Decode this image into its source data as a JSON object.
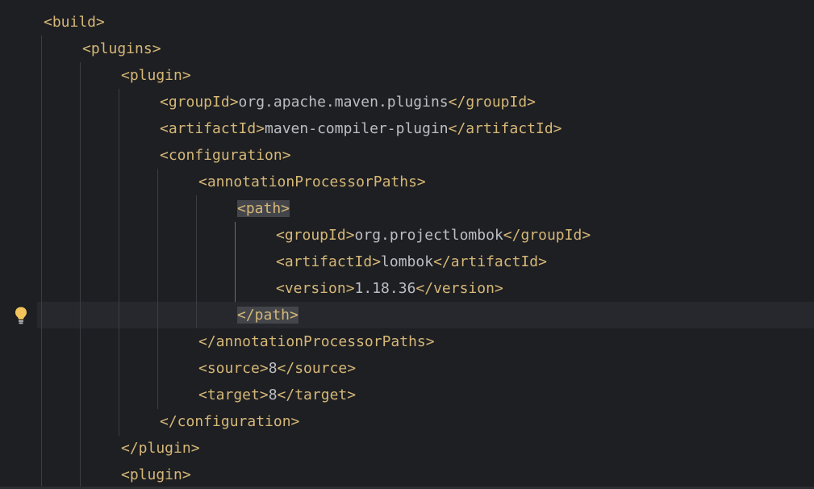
{
  "editor": {
    "icons": {
      "intention": "lightbulb-icon"
    },
    "colors": {
      "background": "#1e1f22",
      "current_line": "#26282e",
      "tag": "#d5b778",
      "text": "#bcbec4",
      "match_highlight": "#43454a",
      "bulb": "#f2c55c"
    },
    "lines": [
      {
        "indent": 0,
        "tokens": [
          {
            "t": "tag",
            "v": "<build>"
          }
        ]
      },
      {
        "indent": 1,
        "tokens": [
          {
            "t": "tag",
            "v": "<plugins>"
          }
        ]
      },
      {
        "indent": 2,
        "tokens": [
          {
            "t": "tag",
            "v": "<plugin>"
          }
        ]
      },
      {
        "indent": 3,
        "tokens": [
          {
            "t": "tag",
            "v": "<groupId>"
          },
          {
            "t": "txt",
            "v": "org.apache.maven.plugins"
          },
          {
            "t": "tag",
            "v": "</groupId>"
          }
        ]
      },
      {
        "indent": 3,
        "tokens": [
          {
            "t": "tag",
            "v": "<artifactId>"
          },
          {
            "t": "txt",
            "v": "maven-compiler-plugin"
          },
          {
            "t": "tag",
            "v": "</artifactId>"
          }
        ]
      },
      {
        "indent": 3,
        "tokens": [
          {
            "t": "tag",
            "v": "<configuration>"
          }
        ]
      },
      {
        "indent": 4,
        "tokens": [
          {
            "t": "tag",
            "v": "<annotationProcessorPaths>"
          }
        ]
      },
      {
        "indent": 5,
        "tokens": [
          {
            "t": "tag",
            "v": "<path>",
            "hl": true
          }
        ]
      },
      {
        "indent": 6,
        "tokens": [
          {
            "t": "tag",
            "v": "<groupId>"
          },
          {
            "t": "txt",
            "v": "org.projectlombok"
          },
          {
            "t": "tag",
            "v": "</groupId>"
          }
        ]
      },
      {
        "indent": 6,
        "tokens": [
          {
            "t": "tag",
            "v": "<artifactId>"
          },
          {
            "t": "txt",
            "v": "lombok"
          },
          {
            "t": "tag",
            "v": "</artifactId>"
          }
        ]
      },
      {
        "indent": 6,
        "tokens": [
          {
            "t": "tag",
            "v": "<version>"
          },
          {
            "t": "txt",
            "v": "1.18.36"
          },
          {
            "t": "tag",
            "v": "</version>"
          }
        ]
      },
      {
        "indent": 5,
        "current": true,
        "tokens": [
          {
            "t": "tag",
            "v": "</path>",
            "hl": true
          }
        ]
      },
      {
        "indent": 4,
        "tokens": [
          {
            "t": "tag",
            "v": "</annotationProcessorPaths>"
          }
        ]
      },
      {
        "indent": 4,
        "tokens": [
          {
            "t": "tag",
            "v": "<source>"
          },
          {
            "t": "txt",
            "v": "8"
          },
          {
            "t": "tag",
            "v": "</source>"
          }
        ]
      },
      {
        "indent": 4,
        "tokens": [
          {
            "t": "tag",
            "v": "<target>"
          },
          {
            "t": "txt",
            "v": "8"
          },
          {
            "t": "tag",
            "v": "</target>"
          }
        ]
      },
      {
        "indent": 3,
        "tokens": [
          {
            "t": "tag",
            "v": "</configuration>"
          }
        ]
      },
      {
        "indent": 2,
        "tokens": [
          {
            "t": "tag",
            "v": "</plugin>"
          }
        ]
      },
      {
        "indent": 2,
        "tokens": [
          {
            "t": "tag",
            "v": "<plugin>"
          }
        ]
      }
    ]
  }
}
